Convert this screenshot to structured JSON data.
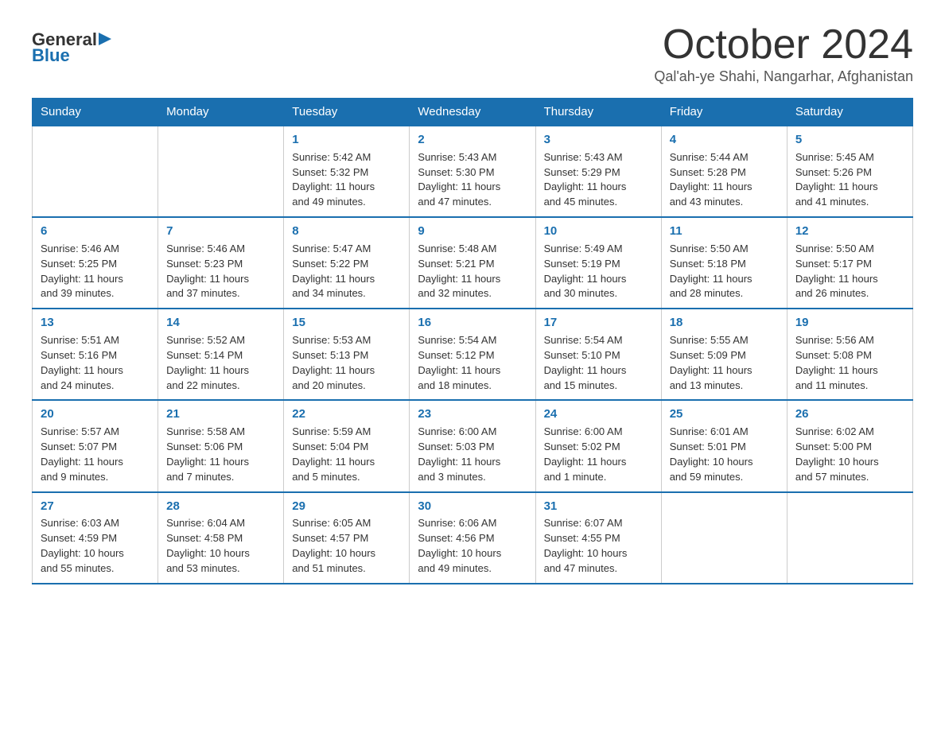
{
  "header": {
    "logo_general": "General",
    "logo_blue": "Blue",
    "month_title": "October 2024",
    "subtitle": "Qal'ah-ye Shahi, Nangarhar, Afghanistan"
  },
  "weekdays": [
    "Sunday",
    "Monday",
    "Tuesday",
    "Wednesday",
    "Thursday",
    "Friday",
    "Saturday"
  ],
  "weeks": [
    [
      {
        "day": "",
        "info": ""
      },
      {
        "day": "",
        "info": ""
      },
      {
        "day": "1",
        "info": "Sunrise: 5:42 AM\nSunset: 5:32 PM\nDaylight: 11 hours\nand 49 minutes."
      },
      {
        "day": "2",
        "info": "Sunrise: 5:43 AM\nSunset: 5:30 PM\nDaylight: 11 hours\nand 47 minutes."
      },
      {
        "day": "3",
        "info": "Sunrise: 5:43 AM\nSunset: 5:29 PM\nDaylight: 11 hours\nand 45 minutes."
      },
      {
        "day": "4",
        "info": "Sunrise: 5:44 AM\nSunset: 5:28 PM\nDaylight: 11 hours\nand 43 minutes."
      },
      {
        "day": "5",
        "info": "Sunrise: 5:45 AM\nSunset: 5:26 PM\nDaylight: 11 hours\nand 41 minutes."
      }
    ],
    [
      {
        "day": "6",
        "info": "Sunrise: 5:46 AM\nSunset: 5:25 PM\nDaylight: 11 hours\nand 39 minutes."
      },
      {
        "day": "7",
        "info": "Sunrise: 5:46 AM\nSunset: 5:23 PM\nDaylight: 11 hours\nand 37 minutes."
      },
      {
        "day": "8",
        "info": "Sunrise: 5:47 AM\nSunset: 5:22 PM\nDaylight: 11 hours\nand 34 minutes."
      },
      {
        "day": "9",
        "info": "Sunrise: 5:48 AM\nSunset: 5:21 PM\nDaylight: 11 hours\nand 32 minutes."
      },
      {
        "day": "10",
        "info": "Sunrise: 5:49 AM\nSunset: 5:19 PM\nDaylight: 11 hours\nand 30 minutes."
      },
      {
        "day": "11",
        "info": "Sunrise: 5:50 AM\nSunset: 5:18 PM\nDaylight: 11 hours\nand 28 minutes."
      },
      {
        "day": "12",
        "info": "Sunrise: 5:50 AM\nSunset: 5:17 PM\nDaylight: 11 hours\nand 26 minutes."
      }
    ],
    [
      {
        "day": "13",
        "info": "Sunrise: 5:51 AM\nSunset: 5:16 PM\nDaylight: 11 hours\nand 24 minutes."
      },
      {
        "day": "14",
        "info": "Sunrise: 5:52 AM\nSunset: 5:14 PM\nDaylight: 11 hours\nand 22 minutes."
      },
      {
        "day": "15",
        "info": "Sunrise: 5:53 AM\nSunset: 5:13 PM\nDaylight: 11 hours\nand 20 minutes."
      },
      {
        "day": "16",
        "info": "Sunrise: 5:54 AM\nSunset: 5:12 PM\nDaylight: 11 hours\nand 18 minutes."
      },
      {
        "day": "17",
        "info": "Sunrise: 5:54 AM\nSunset: 5:10 PM\nDaylight: 11 hours\nand 15 minutes."
      },
      {
        "day": "18",
        "info": "Sunrise: 5:55 AM\nSunset: 5:09 PM\nDaylight: 11 hours\nand 13 minutes."
      },
      {
        "day": "19",
        "info": "Sunrise: 5:56 AM\nSunset: 5:08 PM\nDaylight: 11 hours\nand 11 minutes."
      }
    ],
    [
      {
        "day": "20",
        "info": "Sunrise: 5:57 AM\nSunset: 5:07 PM\nDaylight: 11 hours\nand 9 minutes."
      },
      {
        "day": "21",
        "info": "Sunrise: 5:58 AM\nSunset: 5:06 PM\nDaylight: 11 hours\nand 7 minutes."
      },
      {
        "day": "22",
        "info": "Sunrise: 5:59 AM\nSunset: 5:04 PM\nDaylight: 11 hours\nand 5 minutes."
      },
      {
        "day": "23",
        "info": "Sunrise: 6:00 AM\nSunset: 5:03 PM\nDaylight: 11 hours\nand 3 minutes."
      },
      {
        "day": "24",
        "info": "Sunrise: 6:00 AM\nSunset: 5:02 PM\nDaylight: 11 hours\nand 1 minute."
      },
      {
        "day": "25",
        "info": "Sunrise: 6:01 AM\nSunset: 5:01 PM\nDaylight: 10 hours\nand 59 minutes."
      },
      {
        "day": "26",
        "info": "Sunrise: 6:02 AM\nSunset: 5:00 PM\nDaylight: 10 hours\nand 57 minutes."
      }
    ],
    [
      {
        "day": "27",
        "info": "Sunrise: 6:03 AM\nSunset: 4:59 PM\nDaylight: 10 hours\nand 55 minutes."
      },
      {
        "day": "28",
        "info": "Sunrise: 6:04 AM\nSunset: 4:58 PM\nDaylight: 10 hours\nand 53 minutes."
      },
      {
        "day": "29",
        "info": "Sunrise: 6:05 AM\nSunset: 4:57 PM\nDaylight: 10 hours\nand 51 minutes."
      },
      {
        "day": "30",
        "info": "Sunrise: 6:06 AM\nSunset: 4:56 PM\nDaylight: 10 hours\nand 49 minutes."
      },
      {
        "day": "31",
        "info": "Sunrise: 6:07 AM\nSunset: 4:55 PM\nDaylight: 10 hours\nand 47 minutes."
      },
      {
        "day": "",
        "info": ""
      },
      {
        "day": "",
        "info": ""
      }
    ]
  ]
}
